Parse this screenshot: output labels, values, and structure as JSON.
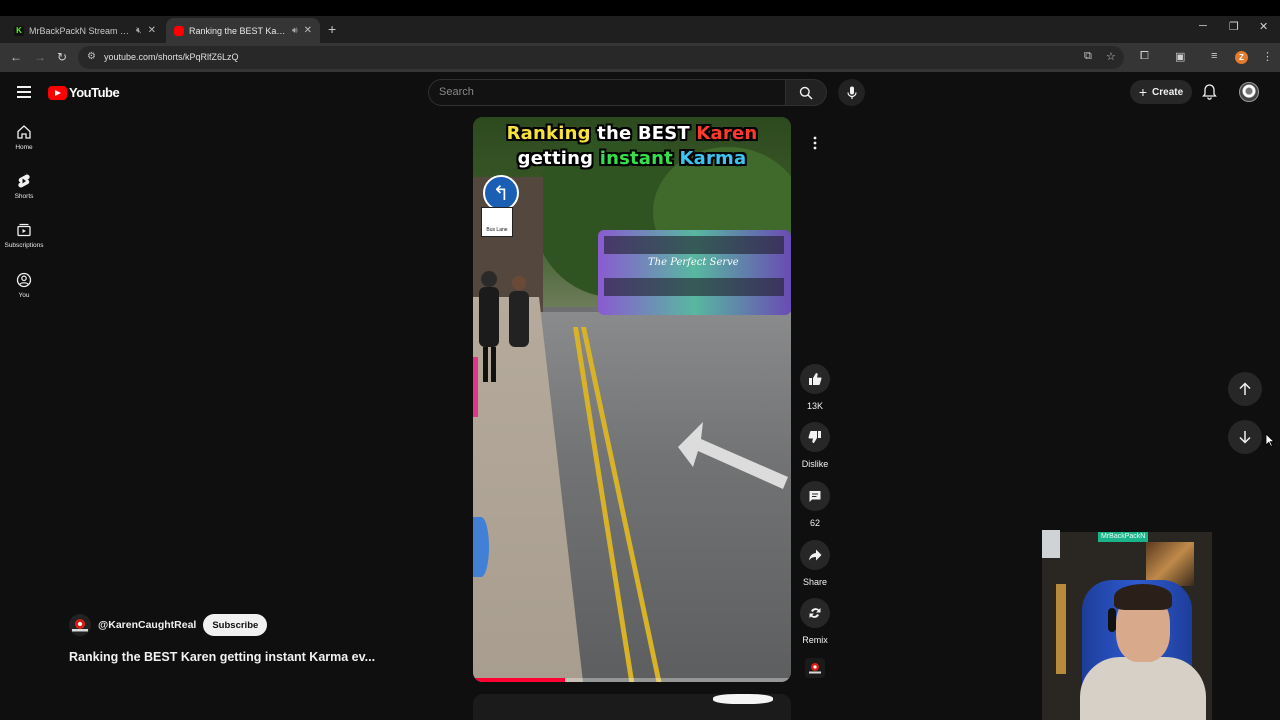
{
  "browser": {
    "tabs": [
      {
        "title": "MrBackPackN Stream - Watch",
        "favicon_letter": "K",
        "active": false
      },
      {
        "title": "Ranking the BEST Karen getting instant Karma",
        "active": true
      }
    ],
    "url": "youtube.com/shorts/kPqRlfZ6LzQ",
    "profile_letter": "Z",
    "colors": {
      "tab_active": "#353535",
      "chrome_bg": "#1f1f1f",
      "profile": "#e37b2e"
    }
  },
  "youtube": {
    "logo_text": "YouTube",
    "search_placeholder": "Search",
    "create_label": "Create",
    "sidebar": [
      {
        "label": "Home",
        "icon": "home-icon"
      },
      {
        "label": "Shorts",
        "icon": "shorts-icon"
      },
      {
        "label": "Subscriptions",
        "icon": "subscriptions-icon"
      },
      {
        "label": "You",
        "icon": "you-icon"
      }
    ],
    "colors": {
      "brand": "#ff0000",
      "bg": "#0f0f0f",
      "button_bg": "#272727"
    }
  },
  "short": {
    "overlay_title": {
      "line1": [
        {
          "text": "Ranking",
          "color": "yellow"
        },
        {
          "text": " the BEST ",
          "color": "white"
        },
        {
          "text": "Karen",
          "color": "red"
        }
      ],
      "line2": [
        {
          "text": "getting ",
          "color": "white"
        },
        {
          "text": "instant",
          "color": "green"
        },
        {
          "text": " Karma",
          "color": "blue"
        }
      ]
    },
    "scene_text": {
      "bus_brand": "The Perfect Serve",
      "bus_sign": "Bus Lane"
    },
    "progress_fraction": 0.29,
    "actions": {
      "like_count": "13K",
      "dislike_label": "Dislike",
      "comment_count": "62",
      "share_label": "Share",
      "remix_label": "Remix"
    },
    "channel": {
      "handle": "@KarenCaughtReal",
      "subscribe_label": "Subscribe"
    },
    "title": "Ranking the BEST Karen getting instant Karma ev..."
  },
  "webcam": {
    "name_tag": "MrBackPackN"
  }
}
